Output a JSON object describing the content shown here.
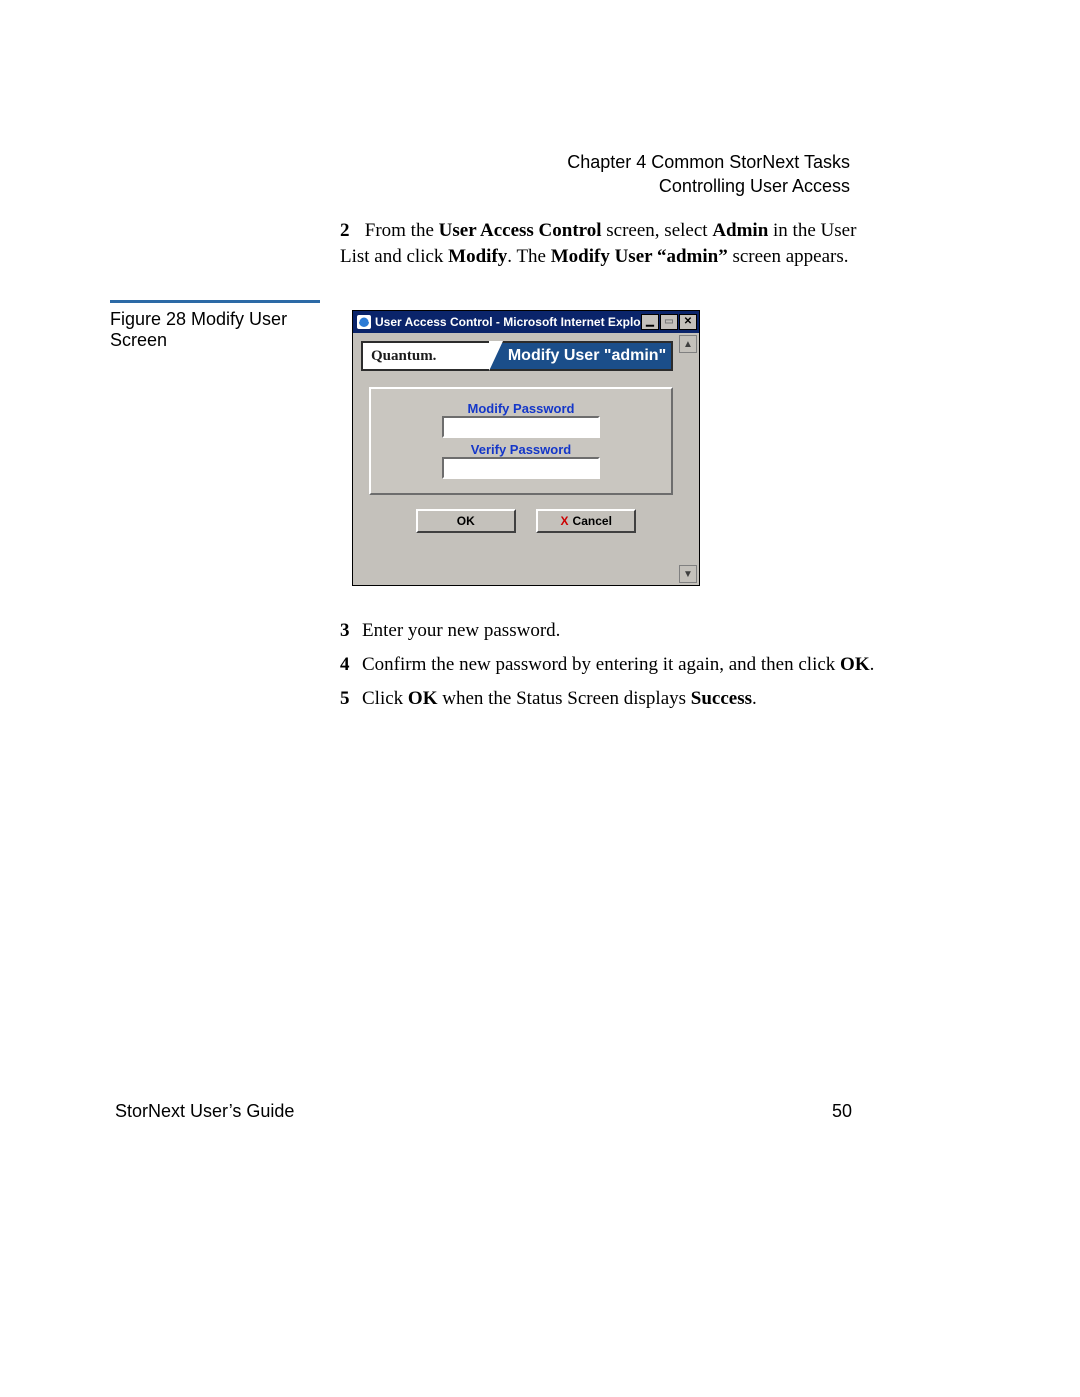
{
  "header": {
    "chapter": "Chapter 4  Common StorNext Tasks",
    "section": "Controlling User Access"
  },
  "step2": {
    "number": "2",
    "pre": "From the ",
    "bold1": "User Access Control",
    "mid1": " screen, select ",
    "bold2": "Admin",
    "mid2": " in the User List and click ",
    "bold3": "Modify",
    "mid3": ". The ",
    "bold4": "Modify User “admin”",
    "post": " screen appears."
  },
  "figure": {
    "caption": "Figure 28  Modify User Screen"
  },
  "window": {
    "title": "User Access Control - Microsoft Internet Explorer",
    "brand": "Quantum.",
    "panel_title": "Modify User \"admin\"",
    "label_modify": "Modify Password",
    "label_verify": "Verify Password",
    "value_modify": "",
    "value_verify": "",
    "btn_ok": "OK",
    "btn_cancel": "Cancel",
    "icon_close": "✕",
    "icon_restore": "▭",
    "icon_min": "▁",
    "icon_up": "▲",
    "icon_down": "▼",
    "cancel_x": "X"
  },
  "steps345": [
    {
      "n": "3",
      "t": "Enter your new password."
    },
    {
      "n": "4",
      "t_pre": "Confirm the new password by entering it again, and then click ",
      "t_bold": "OK",
      "t_post": "."
    },
    {
      "n": "5",
      "t_pre": "Click ",
      "t_bold1": "OK",
      "t_mid": " when the Status Screen displays ",
      "t_bold2": "Success",
      "t_post": "."
    }
  ],
  "footer": {
    "left": "StorNext User’s Guide",
    "right": "50"
  }
}
